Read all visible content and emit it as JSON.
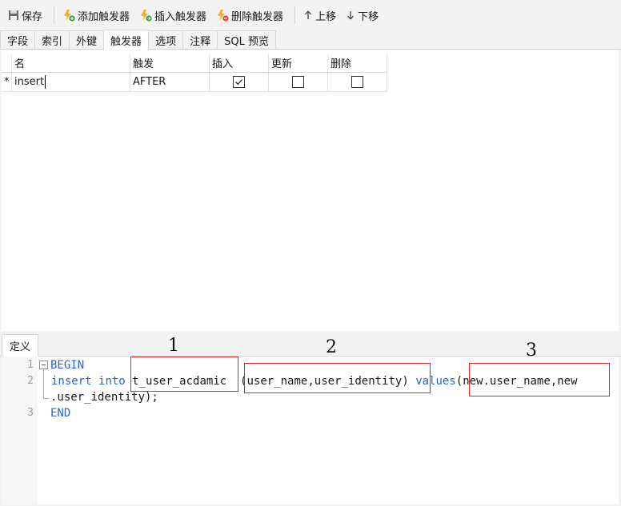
{
  "toolbar": {
    "save_label": "保存",
    "add_trigger_label": "添加触发器",
    "insert_trigger_label": "插入触发器",
    "delete_trigger_label": "删除触发器",
    "move_up_label": "上移",
    "move_down_label": "下移"
  },
  "tabs": [
    "字段",
    "索引",
    "外键",
    "触发器",
    "选项",
    "注释",
    "SQL 预览"
  ],
  "active_tab": "触发器",
  "grid": {
    "columns": [
      "名",
      "触发",
      "插入",
      "更新",
      "删除"
    ],
    "rows": [
      {
        "marker": "*",
        "name": "insert",
        "fires": "AFTER",
        "insert": true,
        "update": false,
        "delete": false
      }
    ]
  },
  "definition": {
    "tab_label": "定义",
    "line_numbers": [
      "1",
      "2",
      "3"
    ],
    "line1": "BEGIN",
    "line2_kw1": "insert",
    "line2_kw2": "into",
    "line2_table": "t_user_acdamic",
    "line2_cols": "(user_name,user_identity)",
    "line2_kw3": "values",
    "line2_vals": "(new.user_name,new",
    "line2_wrap": ".user_identity);",
    "line3": "END",
    "annotations": [
      "1",
      "2",
      "3"
    ]
  },
  "colors": {
    "keyword": "#2a66c9",
    "annotation_box": "#e0262b",
    "delete_icon": "#e8463a",
    "add_icon": "#2ea043"
  }
}
